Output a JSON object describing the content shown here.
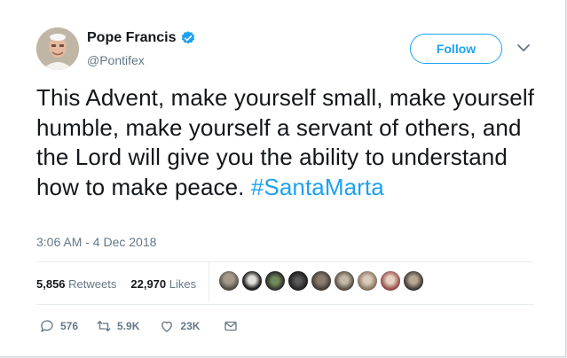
{
  "author": {
    "name": "Pope Francis",
    "handle": "@Pontifex",
    "verified": true
  },
  "follow_label": "Follow",
  "tweet": {
    "text": "This Advent, make yourself small, make yourself humble, make yourself a servant of others, and the Lord will give you the ability to understand how to make peace.",
    "hashtag": "#SantaMarta",
    "timestamp": "3:06 AM - 4 Dec 2018"
  },
  "stats": {
    "retweets_count": "5,856",
    "retweets_label": "Retweets",
    "likes_count": "22,970",
    "likes_label": "Likes"
  },
  "likers_count": 9,
  "actions": {
    "replies": "576",
    "retweets": "5.9K",
    "likes": "23K"
  },
  "colors": {
    "accent": "#1da1f2",
    "muted": "#657786",
    "text": "#14171a"
  }
}
